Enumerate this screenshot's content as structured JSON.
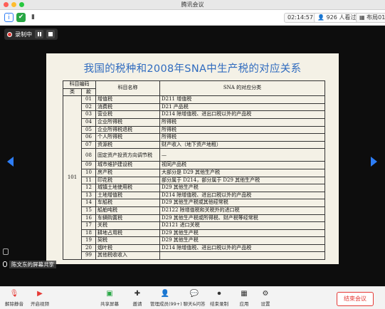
{
  "window": {
    "title": "腾讯会议"
  },
  "infobar": {
    "timer": "02:14:57",
    "viewers": "926 人看过",
    "layout": "布局01"
  },
  "recording": {
    "label": "录制中"
  },
  "slide": {
    "title": "我国的税种和2008年SNA中生产税的对应关系",
    "header": {
      "code_group": "科目编码",
      "cat": "类",
      "item": "款",
      "name": "科目名称",
      "sna": "SNA 的对应分类"
    },
    "category": "101",
    "rows": [
      {
        "code": "01",
        "name": "增值税",
        "sna": "D211 增值税"
      },
      {
        "code": "02",
        "name": "消费税",
        "sna": "D21 产品税"
      },
      {
        "code": "03",
        "name": "营业税",
        "sna": "D214 除增值税、进出口税以外的产品税"
      },
      {
        "code": "04",
        "name": "企业所得税",
        "sna": "所得税"
      },
      {
        "code": "05",
        "name": "企业所得税退税",
        "sna": "所得税"
      },
      {
        "code": "06",
        "name": "个人所得税",
        "sna": "所得税"
      },
      {
        "code": "07",
        "name": "资源税",
        "sna": "财产收入（地下资产地租）"
      },
      {
        "code": "08",
        "name": "固定资产投资方向调节税",
        "sna": "—",
        "tall": true
      },
      {
        "code": "09",
        "name": "城市维护建设税",
        "sna": "视同产品税"
      },
      {
        "code": "10",
        "name": "房产税",
        "sna": "大部分是 D29 其他生产税"
      },
      {
        "code": "11",
        "name": "印花税",
        "sna": "部分属于 D214，部分属于 D29 其他生产税"
      },
      {
        "code": "12",
        "name": "城镇土地使用税",
        "sna": "D29 其他生产税"
      },
      {
        "code": "13",
        "name": "土地增值税",
        "sna": "D214 除增值税、进出口税以外的产品税"
      },
      {
        "code": "14",
        "name": "车船税",
        "sna": "D29 其他生产税或其他经常税"
      },
      {
        "code": "15",
        "name": "船舶吨税",
        "sna": "D2122 除增值税和关税外的进口税"
      },
      {
        "code": "16",
        "name": "车辆购置税",
        "sna": "D29 其他生产税或所得税、财产税等经常税"
      },
      {
        "code": "17",
        "name": "关税",
        "sna": "D2121 进口关税"
      },
      {
        "code": "18",
        "name": "耕地占用税",
        "sna": "D29 其他生产税"
      },
      {
        "code": "19",
        "name": "契税",
        "sna": "D29 其他生产税"
      },
      {
        "code": "20",
        "name": "烟叶税",
        "sna": "D214 除增值税、进出口税以外的产品税"
      },
      {
        "code": "99",
        "name": "其他税收收入",
        "sna": ""
      }
    ]
  },
  "share_tag": "陈文东的屏幕共享",
  "toolbar": {
    "items": [
      {
        "label": "解除静音",
        "icon": "microphone-muted-icon"
      },
      {
        "label": "开启视频",
        "icon": "video-off-icon"
      },
      {
        "label": "共享屏幕",
        "icon": "share-screen-icon"
      },
      {
        "label": "邀请",
        "icon": "invite-icon"
      },
      {
        "label": "管理成员(99+)",
        "icon": "members-icon"
      },
      {
        "label": "聊天&问答",
        "icon": "chat-icon"
      },
      {
        "label": "结束录制",
        "icon": "stop-record-icon"
      },
      {
        "label": "应用",
        "icon": "apps-icon"
      },
      {
        "label": "设置",
        "icon": "settings-icon"
      }
    ],
    "end_meeting": "结束会议"
  },
  "colors": {
    "accent": "#2d7df6",
    "danger": "#e53935",
    "slide_title": "#2f6bbf"
  }
}
